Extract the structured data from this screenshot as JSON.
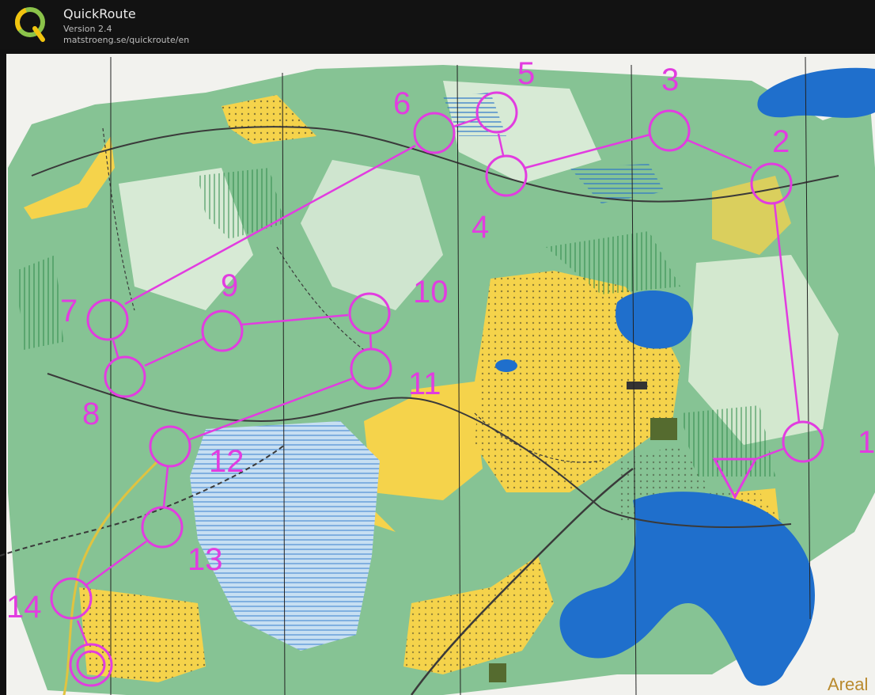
{
  "app": {
    "title": "QuickRoute",
    "version": "Version 2.4",
    "url": "matstroeng.se/quickroute/en"
  },
  "map": {
    "course_color": "#e23ce0",
    "colors": {
      "paper": "#f2f2ee",
      "forest_green": "#7fc08d",
      "open_yellow": "#f5d34b",
      "water_blue": "#1f6fcc",
      "marsh_blue": "#6aa6dd"
    },
    "controls": [
      {
        "number": "1"
      },
      {
        "number": "2"
      },
      {
        "number": "3"
      },
      {
        "number": "4"
      },
      {
        "number": "5"
      },
      {
        "number": "6"
      },
      {
        "number": "7"
      },
      {
        "number": "8"
      },
      {
        "number": "9"
      },
      {
        "number": "10"
      },
      {
        "number": "11"
      },
      {
        "number": "12"
      },
      {
        "number": "13"
      },
      {
        "number": "14"
      }
    ],
    "corner_text": "Areal"
  }
}
